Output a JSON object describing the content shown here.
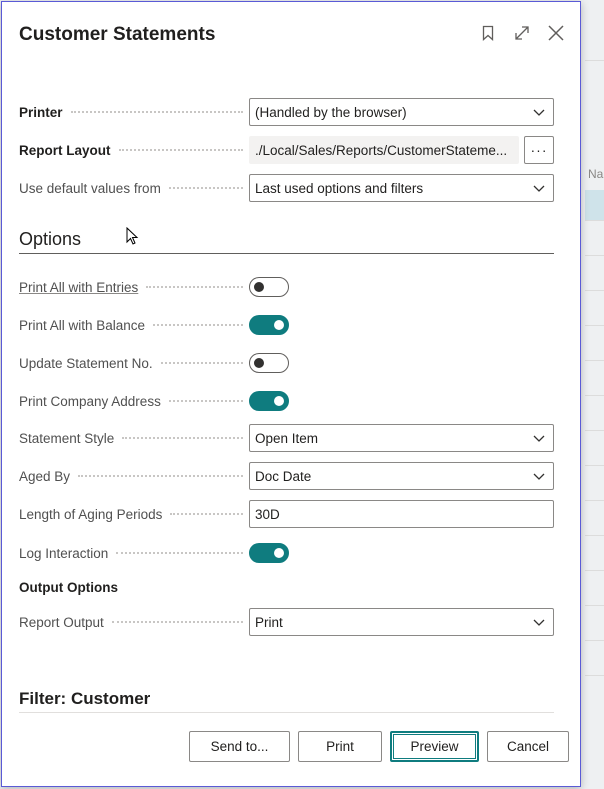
{
  "dialog": {
    "title": "Customer Statements"
  },
  "background": {
    "column_label": "Na"
  },
  "fields": {
    "printer": {
      "label": "Printer",
      "value": "(Handled by the browser)"
    },
    "report_layout": {
      "label": "Report Layout",
      "value": "./Local/Sales/Reports/CustomerStateme...",
      "more": "···"
    },
    "default_values": {
      "label": "Use default values from",
      "value": "Last used options and filters"
    }
  },
  "options": {
    "heading": "Options",
    "print_all_entries": {
      "label": "Print All with Entries",
      "on": false
    },
    "print_all_balance": {
      "label": "Print All with Balance",
      "on": true
    },
    "update_statement_no": {
      "label": "Update Statement No.",
      "on": false
    },
    "print_company_address": {
      "label": "Print Company Address",
      "on": true
    },
    "statement_style": {
      "label": "Statement Style",
      "value": "Open Item"
    },
    "aged_by": {
      "label": "Aged By",
      "value": "Doc Date"
    },
    "aging_periods": {
      "label": "Length of Aging Periods",
      "value": "30D"
    },
    "log_interaction": {
      "label": "Log Interaction",
      "on": true
    }
  },
  "output_options": {
    "heading": "Output Options",
    "report_output": {
      "label": "Report Output",
      "value": "Print"
    }
  },
  "filter": {
    "heading": "Filter: Customer"
  },
  "footer": {
    "send_to": "Send to...",
    "print": "Print",
    "preview": "Preview",
    "cancel": "Cancel"
  },
  "colors": {
    "accent": "#0f7c7f",
    "dialog_border": "#5a5ad6"
  }
}
